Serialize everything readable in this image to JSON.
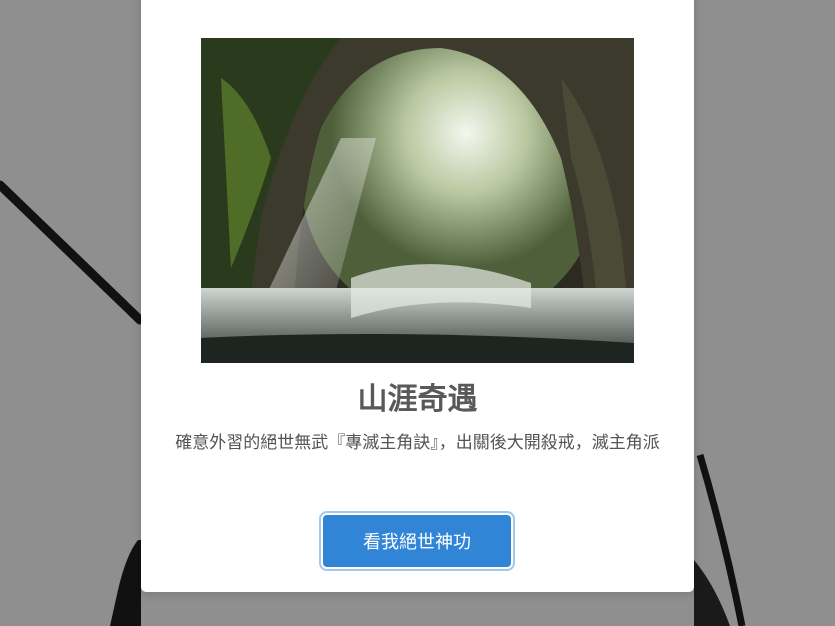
{
  "modal": {
    "image": {
      "icon": "cave-waterfall-photo"
    },
    "title": "山涯奇遇",
    "text": "確意外習的絕世無武『專滅主角訣』，出關後大開殺戒，滅主角派",
    "confirm_label": "看我絕世神功"
  },
  "colors": {
    "overlay": "#8f8f8f",
    "modal_background": "#ffffff",
    "confirm_button": "#3085d6",
    "title": "#595959",
    "text": "#545454"
  }
}
